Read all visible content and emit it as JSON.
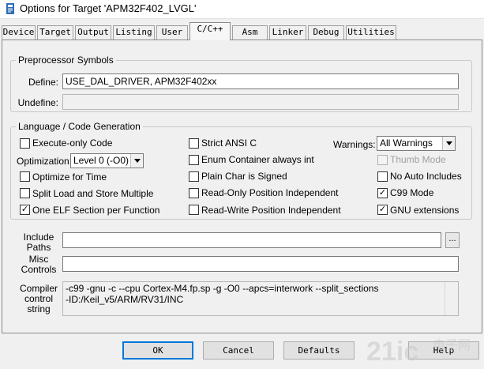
{
  "window": {
    "title": "Options for Target 'APM32F402_LVGL'",
    "icon": "keil-app-icon"
  },
  "tabs": [
    {
      "label": "Device"
    },
    {
      "label": "Target"
    },
    {
      "label": "Output"
    },
    {
      "label": "Listing"
    },
    {
      "label": "User"
    },
    {
      "label": "C/C++",
      "active": true
    },
    {
      "label": "Asm"
    },
    {
      "label": "Linker"
    },
    {
      "label": "Debug"
    },
    {
      "label": "Utilities"
    }
  ],
  "preprocessor": {
    "legend": "Preprocessor Symbols",
    "define_label": "Define:",
    "define_value": "USE_DAL_DRIVER, APM32F402xx",
    "undefine_label": "Undefine:",
    "undefine_value": ""
  },
  "language": {
    "legend": "Language / Code Generation",
    "execute_only": {
      "label": "Execute-only Code",
      "checked": false
    },
    "optimization_label": "Optimization:",
    "optimization_value": "Level 0 (-O0)",
    "optimize_time": {
      "label": "Optimize for Time",
      "checked": false
    },
    "split_load": {
      "label": "Split Load and Store Multiple",
      "checked": false
    },
    "one_elf": {
      "label": "One ELF Section per Function",
      "checked": true,
      "mark": "✓"
    },
    "strict_ansi": {
      "label": "Strict ANSI C",
      "checked": false
    },
    "enum_int": {
      "label": "Enum Container always int",
      "checked": false
    },
    "plain_char": {
      "label": "Plain Char is Signed",
      "checked": false
    },
    "ro_pos": {
      "label": "Read-Only Position Independent",
      "checked": false
    },
    "rw_pos": {
      "label": "Read-Write Position Independent",
      "checked": false
    },
    "warnings_label": "Warnings:",
    "warnings_value": "All Warnings",
    "thumb_mode": {
      "label": "Thumb Mode",
      "checked": false,
      "disabled": true
    },
    "no_auto": {
      "label": "No Auto Includes",
      "checked": false
    },
    "c99": {
      "label": "C99 Mode",
      "checked": true,
      "mark": "✓"
    },
    "gnu_ext": {
      "label": "GNU extensions",
      "checked": true,
      "mark": "✓"
    }
  },
  "include_paths": {
    "label_line1": "Include",
    "label_line2": "Paths",
    "value": "",
    "browse_label": "..."
  },
  "misc_controls": {
    "label_line1": "Misc",
    "label_line2": "Controls",
    "value": ""
  },
  "compiler_string": {
    "label_line1": "Compiler",
    "label_line2": "control",
    "label_line3": "string",
    "line1": "-c99 -gnu -c --cpu Cortex-M4.fp.sp -g -O0 --apcs=interwork --split_sections",
    "line2": "-ID:/Keil_v5/ARM/RV31/INC"
  },
  "buttons": {
    "ok": "OK",
    "cancel": "Cancel",
    "defaults": "Defaults",
    "help": "Help"
  },
  "watermark": {
    "text": "21ic",
    "subtext": "电子网",
    "color": "#c8c8c8"
  }
}
